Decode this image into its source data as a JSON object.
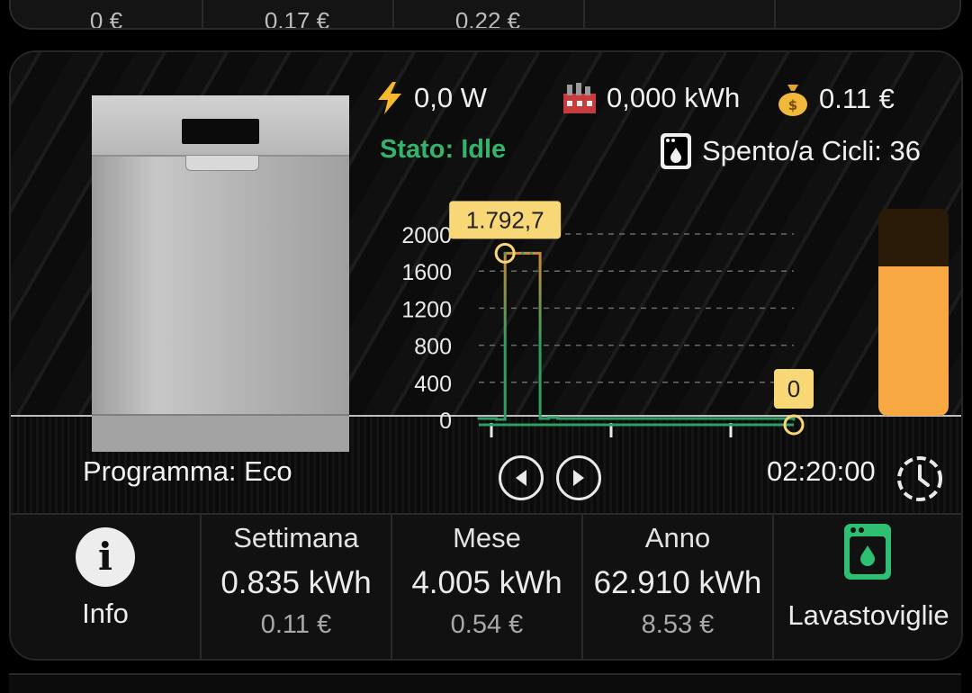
{
  "top_strip": {
    "values": [
      "0 €",
      "0.17 €",
      "0.22 €",
      ""
    ]
  },
  "stats": {
    "power": "0,0 W",
    "energy": "0,000 kWh",
    "cost": "0.11 €",
    "state": "Stato: Idle",
    "cycles": "Spento/a Cicli: 36"
  },
  "program": "Programma: Eco",
  "timer": "02:20:00",
  "level_fraction": 0.72,
  "colors": {
    "state": "#35b36b",
    "accent": "#f7a843",
    "tooltip": "#f8d776",
    "series": "#2f9e62"
  },
  "chart_data": {
    "type": "line",
    "yticks": [
      "0",
      "400",
      "800",
      "1200",
      "1600",
      "2000"
    ],
    "ylim": [
      0,
      2000
    ],
    "x": [
      0,
      1,
      2,
      3,
      4,
      5,
      6,
      7,
      8,
      9,
      10,
      11,
      12,
      13,
      14,
      15,
      16,
      17,
      18,
      19,
      20,
      21,
      22,
      23,
      24,
      25,
      26,
      27,
      28,
      29,
      30,
      31,
      32,
      33,
      34,
      35,
      36
    ],
    "values": [
      10,
      10,
      0,
      1792.7,
      1792.7,
      1792.7,
      1792.7,
      10,
      20,
      10,
      10,
      10,
      10,
      10,
      10,
      10,
      10,
      10,
      10,
      10,
      10,
      10,
      10,
      10,
      10,
      10,
      10,
      10,
      10,
      10,
      10,
      10,
      10,
      10,
      10,
      10,
      0
    ],
    "max_label": "1.792,7",
    "last_label": "0",
    "grid": true
  },
  "tiles": {
    "info": {
      "label": "Info"
    },
    "week": {
      "title": "Settimana",
      "kwh": "0.835 kWh",
      "cost": "0.11 €"
    },
    "month": {
      "title": "Mese",
      "kwh": "4.005 kWh",
      "cost": "0.54 €"
    },
    "year": {
      "title": "Anno",
      "kwh": "62.910 kWh",
      "cost": "8.53 €"
    },
    "device": {
      "label": "Lavastoviglie",
      "icon": "dishwasher-icon"
    }
  }
}
